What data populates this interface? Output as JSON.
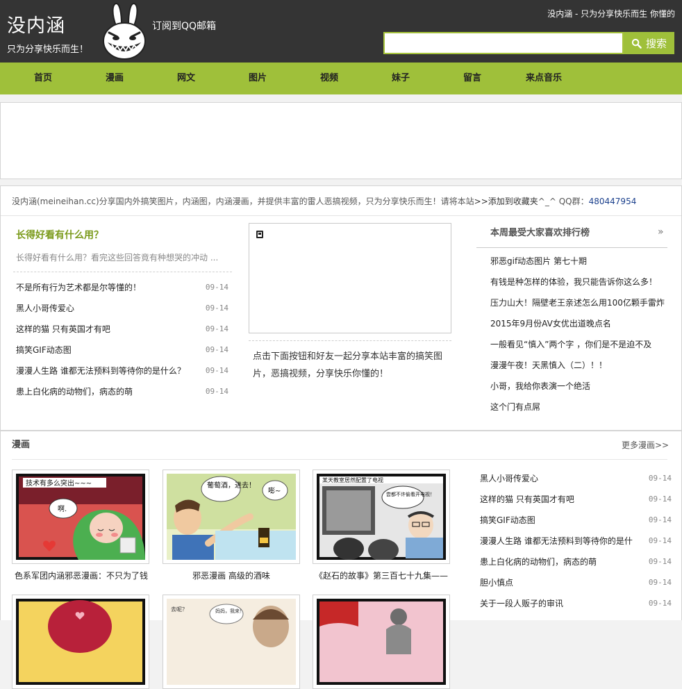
{
  "header": {
    "logo_text": "没内涵",
    "logo_slogan": "只为分享快乐而生！",
    "subscribe": "订阅到QQ邮箱",
    "slogan": "没内涵 - 只为分享快乐而生 你懂的",
    "search_placeholder": "",
    "search_button": "搜索"
  },
  "nav": [
    "首页",
    "漫画",
    "网文",
    "图片",
    "视频",
    "妹子",
    "留言",
    "来点音乐"
  ],
  "intro": {
    "text": "没内涵(meineihan.cc)分享国内外搞笑图片，内涵图，内涵漫画，并提供丰富的雷人恶搞视频，只为分享快乐而生！请将本站",
    "bookmark": ">>添加到收藏夹",
    "after": "^_^ QQ群：",
    "qq": "480447954"
  },
  "featured": {
    "title": "长得好看有什么用？",
    "desc": "长得好看有什么用？看完这些回答竟有种想哭的冲动 ...",
    "items": [
      {
        "title": "不是所有行为艺术都是尔等懂的！",
        "date": "09-14"
      },
      {
        "title": "黑人小哥传爱心",
        "date": "09-14"
      },
      {
        "title": "这样的猫 只有英国才有吧",
        "date": "09-14"
      },
      {
        "title": "搞笑GIF动态图",
        "date": "09-14"
      },
      {
        "title": "漫漫人生路 谁都无法预料到等待你的是什么？",
        "date": "09-14"
      },
      {
        "title": "患上白化病的动物们，病态的萌",
        "date": "09-14"
      }
    ]
  },
  "share_text": "点击下面按钮和好友一起分享本站丰富的搞笑图片，恶搞视频，分享快乐你懂的！",
  "ranking": {
    "title": "本周最受大家喜欢排行榜",
    "more": "»",
    "items": [
      "邪恶gif动态图片 第七十期",
      "有钱是种怎样的体验，我只能告诉你这么多！",
      "压力山大！隔壁老王亲述怎么用100亿颗手雷炸",
      "2015年9月份AV女优出道晚点名",
      "一般看见“慎入”两个字 ，你们是不是迫不及",
      "漫漫午夜！天黑慎入（二）！！",
      "小哥，我给你表演一个绝活",
      "这个门有点屌"
    ]
  },
  "comics": {
    "title": "漫画",
    "more": "更多漫画>>",
    "thumbs": [
      {
        "caption": "色系军团内涵邪恶漫画：不只为了钱",
        "bubble1": "技术有多么突出~~~",
        "bubble2": "啊."
      },
      {
        "caption": "邪恶漫画 高级的酒味",
        "bubble1": "葡萄酒，进去！",
        "bubble2": "嘭~"
      },
      {
        "caption": "《赵石的故事》第三百七十九集——",
        "bubble1": "某天教室居然配置了电视",
        "bubble2": "尝都不许偷看开电视！"
      },
      {
        "caption": "",
        "bubble1": "",
        "bubble2": ""
      },
      {
        "caption": "",
        "bubble1": "去呢？",
        "bubble2": "妈妈，我来！"
      },
      {
        "caption": "",
        "bubble1": "",
        "bubble2": ""
      }
    ],
    "side_items": [
      {
        "title": "黑人小哥传爱心",
        "date": "09-14"
      },
      {
        "title": "这样的猫 只有英国才有吧",
        "date": "09-14"
      },
      {
        "title": "搞笑GIF动态图",
        "date": "09-14"
      },
      {
        "title": "漫漫人生路 谁都无法预料到等待你的是什",
        "date": "09-14"
      },
      {
        "title": "患上白化病的动物们，病态的萌",
        "date": "09-14"
      },
      {
        "title": "胆小慎点",
        "date": "09-14"
      },
      {
        "title": "关于一段人贩子的审讯",
        "date": "09-14"
      }
    ]
  },
  "colors": {
    "header_bg": "#343434",
    "accent": "#9fc03a",
    "featured_title": "#7a9a1a",
    "link_blue": "#1a3f8c"
  }
}
